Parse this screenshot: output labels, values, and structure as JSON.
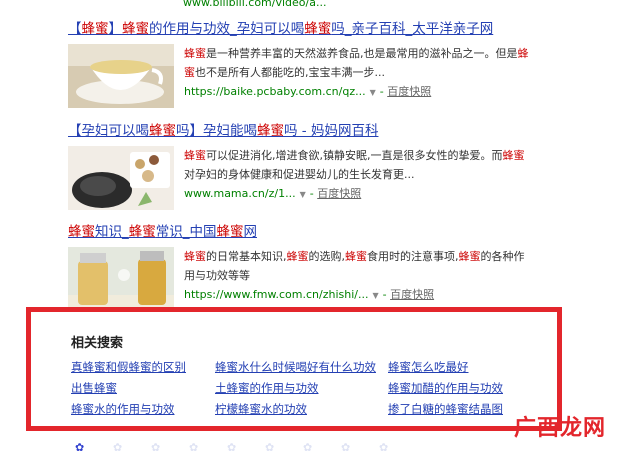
{
  "top_clip_url": "www.bilibili.com/video/a...",
  "results": [
    {
      "title_parts": [
        {
          "t": "【",
          "hl": false
        },
        {
          "t": "蜂蜜",
          "hl": true
        },
        {
          "t": "】",
          "hl": false
        },
        {
          "t": "蜂蜜",
          "hl": true
        },
        {
          "t": "的作用与功效_孕妇可以喝",
          "hl": false
        },
        {
          "t": "蜂蜜",
          "hl": true
        },
        {
          "t": "吗_亲子百科_太平洋亲子网",
          "hl": false
        }
      ],
      "text_parts": [
        {
          "t": "蜂蜜",
          "hl": true
        },
        {
          "t": "是一种营养丰富的天然滋养食品,也是最常用的滋补品之一。但是",
          "hl": false
        },
        {
          "t": "蜂蜜",
          "hl": true
        },
        {
          "t": "也不是所有人都能吃的,宝宝丰满一步...",
          "hl": false
        }
      ],
      "url": "https://baike.pcbaby.com.cn/qz...",
      "snapshot": "百度快照"
    },
    {
      "title_parts": [
        {
          "t": "【孕妇可以喝",
          "hl": false
        },
        {
          "t": "蜂蜜",
          "hl": true
        },
        {
          "t": "吗】孕妇能喝",
          "hl": false
        },
        {
          "t": "蜂蜜",
          "hl": true
        },
        {
          "t": "吗 - 妈妈网百科",
          "hl": false
        }
      ],
      "text_parts": [
        {
          "t": "蜂蜜",
          "hl": true
        },
        {
          "t": "可以促进消化,增进食欲,镇静安眠,一直是很多女性的挚爱。而",
          "hl": false
        },
        {
          "t": "蜂蜜",
          "hl": true
        },
        {
          "t": "对孕妇的身体健康和促进婴幼儿的生长发育更...",
          "hl": false
        }
      ],
      "url": "www.mama.cn/z/1...",
      "snapshot": "百度快照"
    },
    {
      "title_parts": [
        {
          "t": "蜂蜜",
          "hl": true
        },
        {
          "t": "知识_",
          "hl": false
        },
        {
          "t": "蜂蜜",
          "hl": true
        },
        {
          "t": "常识_中国",
          "hl": false
        },
        {
          "t": "蜂蜜",
          "hl": true
        },
        {
          "t": "网",
          "hl": false
        }
      ],
      "text_parts": [
        {
          "t": "蜂蜜",
          "hl": true
        },
        {
          "t": "的日常基本知识,",
          "hl": false
        },
        {
          "t": "蜂蜜",
          "hl": true
        },
        {
          "t": "的选购,",
          "hl": false
        },
        {
          "t": "蜂蜜",
          "hl": true
        },
        {
          "t": "食用时的注意事项,",
          "hl": false
        },
        {
          "t": "蜂蜜",
          "hl": true
        },
        {
          "t": "的各种作用与功效等等",
          "hl": false
        }
      ],
      "url": "https://www.fmw.com.cn/zhishi/...",
      "snapshot": "百度快照"
    }
  ],
  "related": {
    "heading": "相关搜索",
    "links": [
      "真蜂蜜和假蜂蜜的区别",
      "蜂蜜水什么时候喝好有什么功效",
      "蜂蜜怎么吃最好",
      "出售蜂蜜",
      "土蜂蜜的作用与功效",
      "蜂蜜加醋的作用与功效",
      "蜂蜜水的作用与功效",
      "柠檬蜂蜜水的功效",
      "掺了白糖的蜂蜜结晶图"
    ]
  },
  "watermark": "广西龙网",
  "colors": {
    "link": "#2440b3",
    "highlight": "#cc0000",
    "url": "#008000",
    "box": "#e3262c"
  },
  "icons": [
    "paw-icon"
  ]
}
